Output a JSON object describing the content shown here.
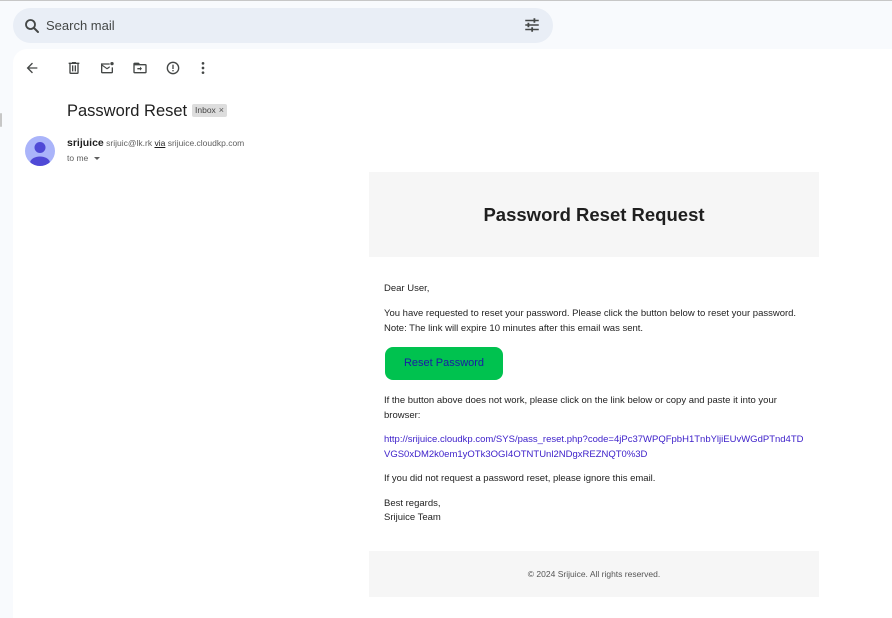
{
  "search": {
    "placeholder": "Search mail"
  },
  "toolbar": {
    "icons": [
      "back-arrow-icon",
      "delete-icon",
      "mark-unread-icon",
      "move-to-icon",
      "report-spam-icon",
      "more-vert-icon"
    ]
  },
  "message": {
    "subject": "Password Reset",
    "label": "Inbox",
    "label_remove": "×",
    "sender_name": "srijuice",
    "sender_email": "srijuic@lk.rk",
    "via_label": "via",
    "via_domain": "srijuice.cloudkp.com",
    "to_label": "to me"
  },
  "email": {
    "header_title": "Password Reset Request",
    "greeting": "Dear User,",
    "intro": "You have requested to reset your password. Please click the button below to reset your password. Note: The link will expire 10 minutes after this email was sent.",
    "button_label": "Reset Password",
    "fallback_text": "If the button above does not work, please click on the link below or copy and paste it into your browser:",
    "reset_link": "http://srijuice.cloudkp.com/SYS/pass_reset.php?code=4jPc37WPQFpbH1TnbYljiEUvWGdPTnd4TDVGS0xDM2k0em1yOTk3OGI4OTNTUnl2NDgxREZNQT0%3D",
    "ignore_text": "If you did not request a password reset, please ignore this email.",
    "sign_off": "Best regards,",
    "signature": "Srijuice Team",
    "footer": "© 2024 Srijuice. All rights reserved."
  },
  "colors": {
    "button_bg": "#00c24f",
    "button_text": "#1a1aa6",
    "link": "#3b1ec9",
    "avatar": "#aab4fa"
  }
}
